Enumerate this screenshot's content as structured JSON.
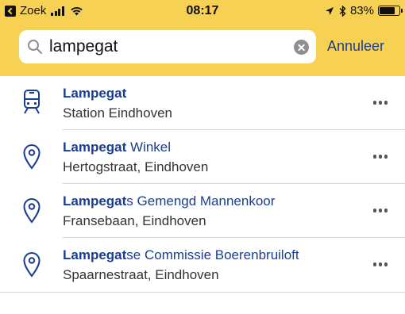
{
  "status_bar": {
    "carrier": "Zoek",
    "time": "08:17",
    "battery_text": "83%",
    "battery_level": 0.83
  },
  "search": {
    "value": "lampegat",
    "placeholder": ""
  },
  "cancel_label": "Annuleer",
  "results": [
    {
      "icon": "train-icon",
      "title_bold": "Lampegat",
      "title_rest": "",
      "subtitle": "Station Eindhoven"
    },
    {
      "icon": "location-pin-icon",
      "title_bold": "Lampegat",
      "title_rest": " Winkel",
      "subtitle": "Hertogstraat, Eindhoven"
    },
    {
      "icon": "location-pin-icon",
      "title_bold": "Lampegat",
      "title_rest": "s Gemengd Mannenkoor",
      "subtitle": "Fransebaan, Eindhoven"
    },
    {
      "icon": "location-pin-icon",
      "title_bold": "Lampegat",
      "title_rest": "se Commissie Boerenbruiloft",
      "subtitle": "Spaarnestraat, Eindhoven"
    }
  ],
  "colors": {
    "header": "#f7d153",
    "accent": "#1c3d8f"
  }
}
